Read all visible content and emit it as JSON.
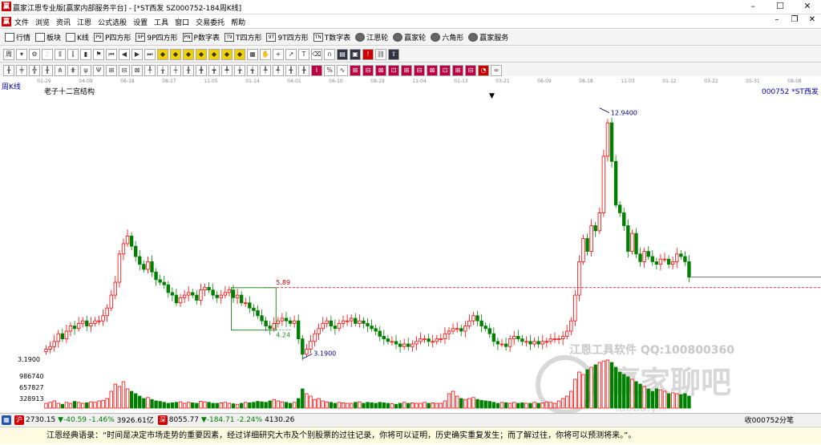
{
  "window": {
    "title": "赢家江恩专业版[赢家内部服务平台] - [*ST西发  SZ000752-184周K线]",
    "app_icon": "赢",
    "buttons": [
      "–",
      "☐",
      "✕"
    ]
  },
  "menu": {
    "items": [
      "文件",
      "浏览",
      "资讯",
      "江恩",
      "公式选股",
      "设置",
      "工具",
      "窗口",
      "交易委托",
      "帮助"
    ],
    "right_buttons": [
      "–",
      "❐",
      "✕"
    ]
  },
  "toolbar1": {
    "buttons": [
      {
        "label": "行情",
        "icon": "grid-icon"
      },
      {
        "label": "板块",
        "icon": "grid-icon"
      },
      {
        "label": "K线",
        "icon": "candle-icon"
      },
      {
        "label": "P四方形",
        "icon": "square-icon",
        "glyph": "P9"
      },
      {
        "label": "9P四方形",
        "icon": "square-icon",
        "glyph": "9P"
      },
      {
        "label": "P数字表",
        "icon": "table-icon",
        "glyph": "PN"
      },
      {
        "label": "T四方形",
        "icon": "square-icon",
        "glyph": "T9"
      },
      {
        "label": "9T四方形",
        "icon": "square-icon",
        "glyph": "9T"
      },
      {
        "label": "T数字表",
        "icon": "table-icon",
        "glyph": "TN"
      },
      {
        "label": "江恩轮",
        "icon": "wheel-icon"
      },
      {
        "label": "赢家轮",
        "icon": "wheel-icon"
      },
      {
        "label": "六角形",
        "icon": "hexagon-icon"
      },
      {
        "label": "赢家服务",
        "icon": "service-icon"
      }
    ]
  },
  "chart_header": {
    "period": "周K线",
    "study": "老子十二宫结构",
    "symbol": "000752 *ST西发",
    "dropdown_marker": "▼"
  },
  "time_axis_labels": [
    "01-29",
    "04-09",
    "06-18",
    "08-27",
    "11-05",
    "01-14",
    "04-01",
    "06-10",
    "08-19",
    "11-04",
    "01-13",
    "03-21",
    "06-09",
    "08-18",
    "11-03",
    "01-12",
    "03-22",
    "05-31",
    "08-08"
  ],
  "price_labels": {
    "high": "12.9400",
    "level_589": "5.89",
    "level_424": "4.24",
    "low_marker": "3.1900",
    "axis_low": "3.1900"
  },
  "volume_axis": [
    "986740",
    "657827",
    "328913"
  ],
  "watermarks": {
    "tool": "江恩工具软件  QQ:100800360",
    "brand": "赢家聊吧",
    "site": "iaoba.y..."
  },
  "status": {
    "sh_icon": "沪",
    "sh_index": "2730.15",
    "sh_change": "▼-40.59",
    "sh_pct": "-1.46%",
    "sh_amount": "3926.61亿",
    "sz_icon": "深",
    "sz_index": "8055.77",
    "sz_change": "▼-184.71",
    "sz_pct": "-2.24%",
    "sz_amount": "4130.26",
    "right_text": "收000752分笔"
  },
  "quote": "江恩经典语录：“时间是决定市场走势的重要因素，经过详细研究大市及个别股票的过往记录，你将可以证明，历史确实重复发生；而了解过往，你将可以预测将来。”。",
  "colors": {
    "up": "#ff0000",
    "down": "#008000",
    "ma": "#000080",
    "line": "#cc0000"
  },
  "chart_data": {
    "type": "candlestick",
    "symbol": "000752 *ST西发",
    "period": "周K线",
    "ylim": [
      3.19,
      12.94
    ],
    "x": [
      "01-29",
      "04-09",
      "06-18",
      "08-27",
      "11-05",
      "01-14",
      "04-01",
      "06-10",
      "08-19",
      "11-04",
      "01-13",
      "03-21",
      "06-09",
      "08-18",
      "11-03",
      "01-12",
      "03-22",
      "05-31",
      "08-08"
    ],
    "closes": [
      3.5,
      3.6,
      3.8,
      4.1,
      3.9,
      4.2,
      4.4,
      4.3,
      4.5,
      4.6,
      4.4,
      4.5,
      4.6,
      4.6,
      4.8,
      5.1,
      5.6,
      6.1,
      7.2,
      7.6,
      7.9,
      7.5,
      7.1,
      6.8,
      6.6,
      6.9,
      6.5,
      6.2,
      6.1,
      6.0,
      5.7,
      5.6,
      5.3,
      5.5,
      5.6,
      5.7,
      5.6,
      5.4,
      5.8,
      5.9,
      5.8,
      5.6,
      5.5,
      5.6,
      5.7,
      5.8,
      5.5,
      5.6,
      5.3,
      5.3,
      5.1,
      5.0,
      4.8,
      4.6,
      4.4,
      4.3,
      4.5,
      4.6,
      4.7,
      4.6,
      4.5,
      4.6,
      3.9,
      3.3,
      3.5,
      3.8,
      4.1,
      4.3,
      4.5,
      4.6,
      4.4,
      4.3,
      4.5,
      4.6,
      4.6,
      4.7,
      4.5,
      4.6,
      4.5,
      4.4,
      4.3,
      4.2,
      4.0,
      3.9,
      3.8,
      3.8,
      3.7,
      3.6,
      3.7,
      3.6,
      3.7,
      3.8,
      3.9,
      3.9,
      3.8,
      3.8,
      3.9,
      3.9,
      4.1,
      4.2,
      4.3,
      4.3,
      4.2,
      4.4,
      4.6,
      4.8,
      4.6,
      4.4,
      4.3,
      4.1,
      3.8,
      3.7,
      3.7,
      3.6,
      3.9,
      4.0,
      3.9,
      3.8,
      3.8,
      3.7,
      3.8,
      3.7,
      3.8,
      3.8,
      3.9,
      3.9,
      3.9,
      4.0,
      4.2,
      4.6,
      5.6,
      6.9,
      7.8,
      7.3,
      8.3,
      8.1,
      8.8,
      11.0,
      12.3,
      10.8,
      9.1,
      8.8,
      8.3,
      7.3,
      8.0,
      7.2,
      6.9,
      7.3,
      7.1,
      6.9,
      6.8,
      7.0,
      7.0,
      6.8,
      6.9,
      7.2,
      7.1,
      6.9,
      6.3
    ],
    "volumes": [
      0.1,
      0.12,
      0.15,
      0.1,
      0.08,
      0.12,
      0.1,
      0.14,
      0.12,
      0.1,
      0.11,
      0.13,
      0.12,
      0.15,
      0.16,
      0.2,
      0.35,
      0.5,
      0.45,
      0.55,
      0.4,
      0.35,
      0.3,
      0.25,
      0.2,
      0.22,
      0.18,
      0.15,
      0.14,
      0.12,
      0.1,
      0.11,
      0.12,
      0.13,
      0.1,
      0.12,
      0.11,
      0.1,
      0.14,
      0.13,
      0.12,
      0.1,
      0.1,
      0.11,
      0.12,
      0.1,
      0.09,
      0.08,
      0.1,
      0.12,
      0.11,
      0.12,
      0.14,
      0.13,
      0.12,
      0.15,
      0.18,
      0.15,
      0.13,
      0.12,
      0.1,
      0.12,
      0.2,
      0.4,
      0.3,
      0.25,
      0.18,
      0.2,
      0.15,
      0.13,
      0.12,
      0.1,
      0.12,
      0.11,
      0.1,
      0.1,
      0.12,
      0.13,
      0.1,
      0.12,
      0.11,
      0.1,
      0.12,
      0.11,
      0.1,
      0.09,
      0.08,
      0.1,
      0.12,
      0.1,
      0.11,
      0.1,
      0.1,
      0.12,
      0.1,
      0.11,
      0.1,
      0.1,
      0.15,
      0.3,
      0.35,
      0.25,
      0.2,
      0.18,
      0.2,
      0.22,
      0.18,
      0.16,
      0.15,
      0.14,
      0.12,
      0.1,
      0.12,
      0.11,
      0.1,
      0.12,
      0.1,
      0.11,
      0.1,
      0.1,
      0.12,
      0.1,
      0.11,
      0.13,
      0.12,
      0.1,
      0.15,
      0.2,
      0.25,
      0.35,
      0.6,
      0.75,
      0.7,
      0.8,
      0.85,
      0.9,
      0.95,
      0.98,
      1.0,
      0.95,
      0.85,
      0.75,
      0.7,
      0.65,
      0.6,
      0.55,
      0.5,
      0.45,
      0.4,
      0.35,
      0.4,
      0.38,
      0.35,
      0.3,
      0.32,
      0.3,
      0.28,
      0.3,
      0.25
    ],
    "horizontal_levels": [
      5.89,
      6.3
    ],
    "box": {
      "from_index": 46,
      "to_index": 56,
      "top": 5.89,
      "bottom": 4.24
    },
    "annotations": [
      {
        "text": "12.9400",
        "value": 12.94
      },
      {
        "text": "3.1900",
        "value": 3.19
      },
      {
        "text": "5.89",
        "value": 5.89
      },
      {
        "text": "4.24",
        "value": 4.24
      }
    ]
  }
}
